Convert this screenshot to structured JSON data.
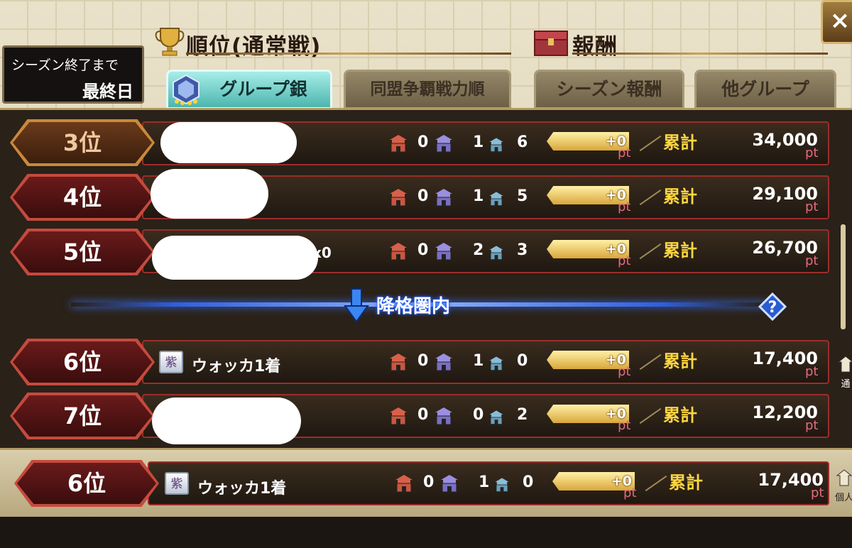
{
  "header": {
    "ranking_title": "順位(通常戦)",
    "reward_title": "報酬",
    "close_label": "×"
  },
  "season": {
    "line1": "シーズン終了まで",
    "line2": "最終日"
  },
  "tabs": [
    {
      "label": "グループ銀",
      "active": true
    },
    {
      "label": "同盟争覇戦力順",
      "active": false
    },
    {
      "label": "シーズン報酬",
      "active": false
    },
    {
      "label": "他グループ",
      "active": false
    }
  ],
  "rows": [
    {
      "rank": "3位",
      "name": "",
      "c1": "0",
      "c2": "1",
      "c3": "6",
      "pt_delta": "+0",
      "pt_unit": "pt",
      "ruikei": "累計",
      "total": "34,000",
      "total_unit": "pt"
    },
    {
      "rank": "4位",
      "name": "",
      "c1": "0",
      "c2": "1",
      "c3": "5",
      "pt_delta": "+0",
      "pt_unit": "pt",
      "ruikei": "累計",
      "total": "29,100",
      "total_unit": "pt"
    },
    {
      "rank": "5位",
      "name": "x0",
      "c1": "0",
      "c2": "2",
      "c3": "3",
      "pt_delta": "+0",
      "pt_unit": "pt",
      "ruikei": "累計",
      "total": "26,700",
      "total_unit": "pt"
    },
    {
      "rank": "6位",
      "badge": "紫",
      "name": "ウォッカ1着",
      "c1": "0",
      "c2": "1",
      "c3": "0",
      "pt_delta": "+0",
      "pt_unit": "pt",
      "ruikei": "累計",
      "total": "17,400",
      "total_unit": "pt"
    },
    {
      "rank": "7位",
      "name": "",
      "c1": "0",
      "c2": "0",
      "c3": "2",
      "pt_delta": "+0",
      "pt_unit": "pt",
      "ruikei": "累計",
      "total": "12,200",
      "total_unit": "pt"
    }
  ],
  "demotion": {
    "label": "降格圏内",
    "help": "?"
  },
  "self_row": {
    "rank": "6位",
    "badge": "紫",
    "name": "ウォッカ1着",
    "c1": "0",
    "c2": "1",
    "c3": "0",
    "pt_delta": "+0",
    "pt_unit": "pt",
    "ruikei": "累計",
    "total": "17,400",
    "total_unit": "pt"
  },
  "side": {
    "label1": "通",
    "label2": "個人"
  },
  "colors": {
    "accent_red": "#9b2d2a",
    "gold": "#ffd740",
    "pt_pink": "#e56a7d",
    "tab_active": "#4cb6ae"
  }
}
